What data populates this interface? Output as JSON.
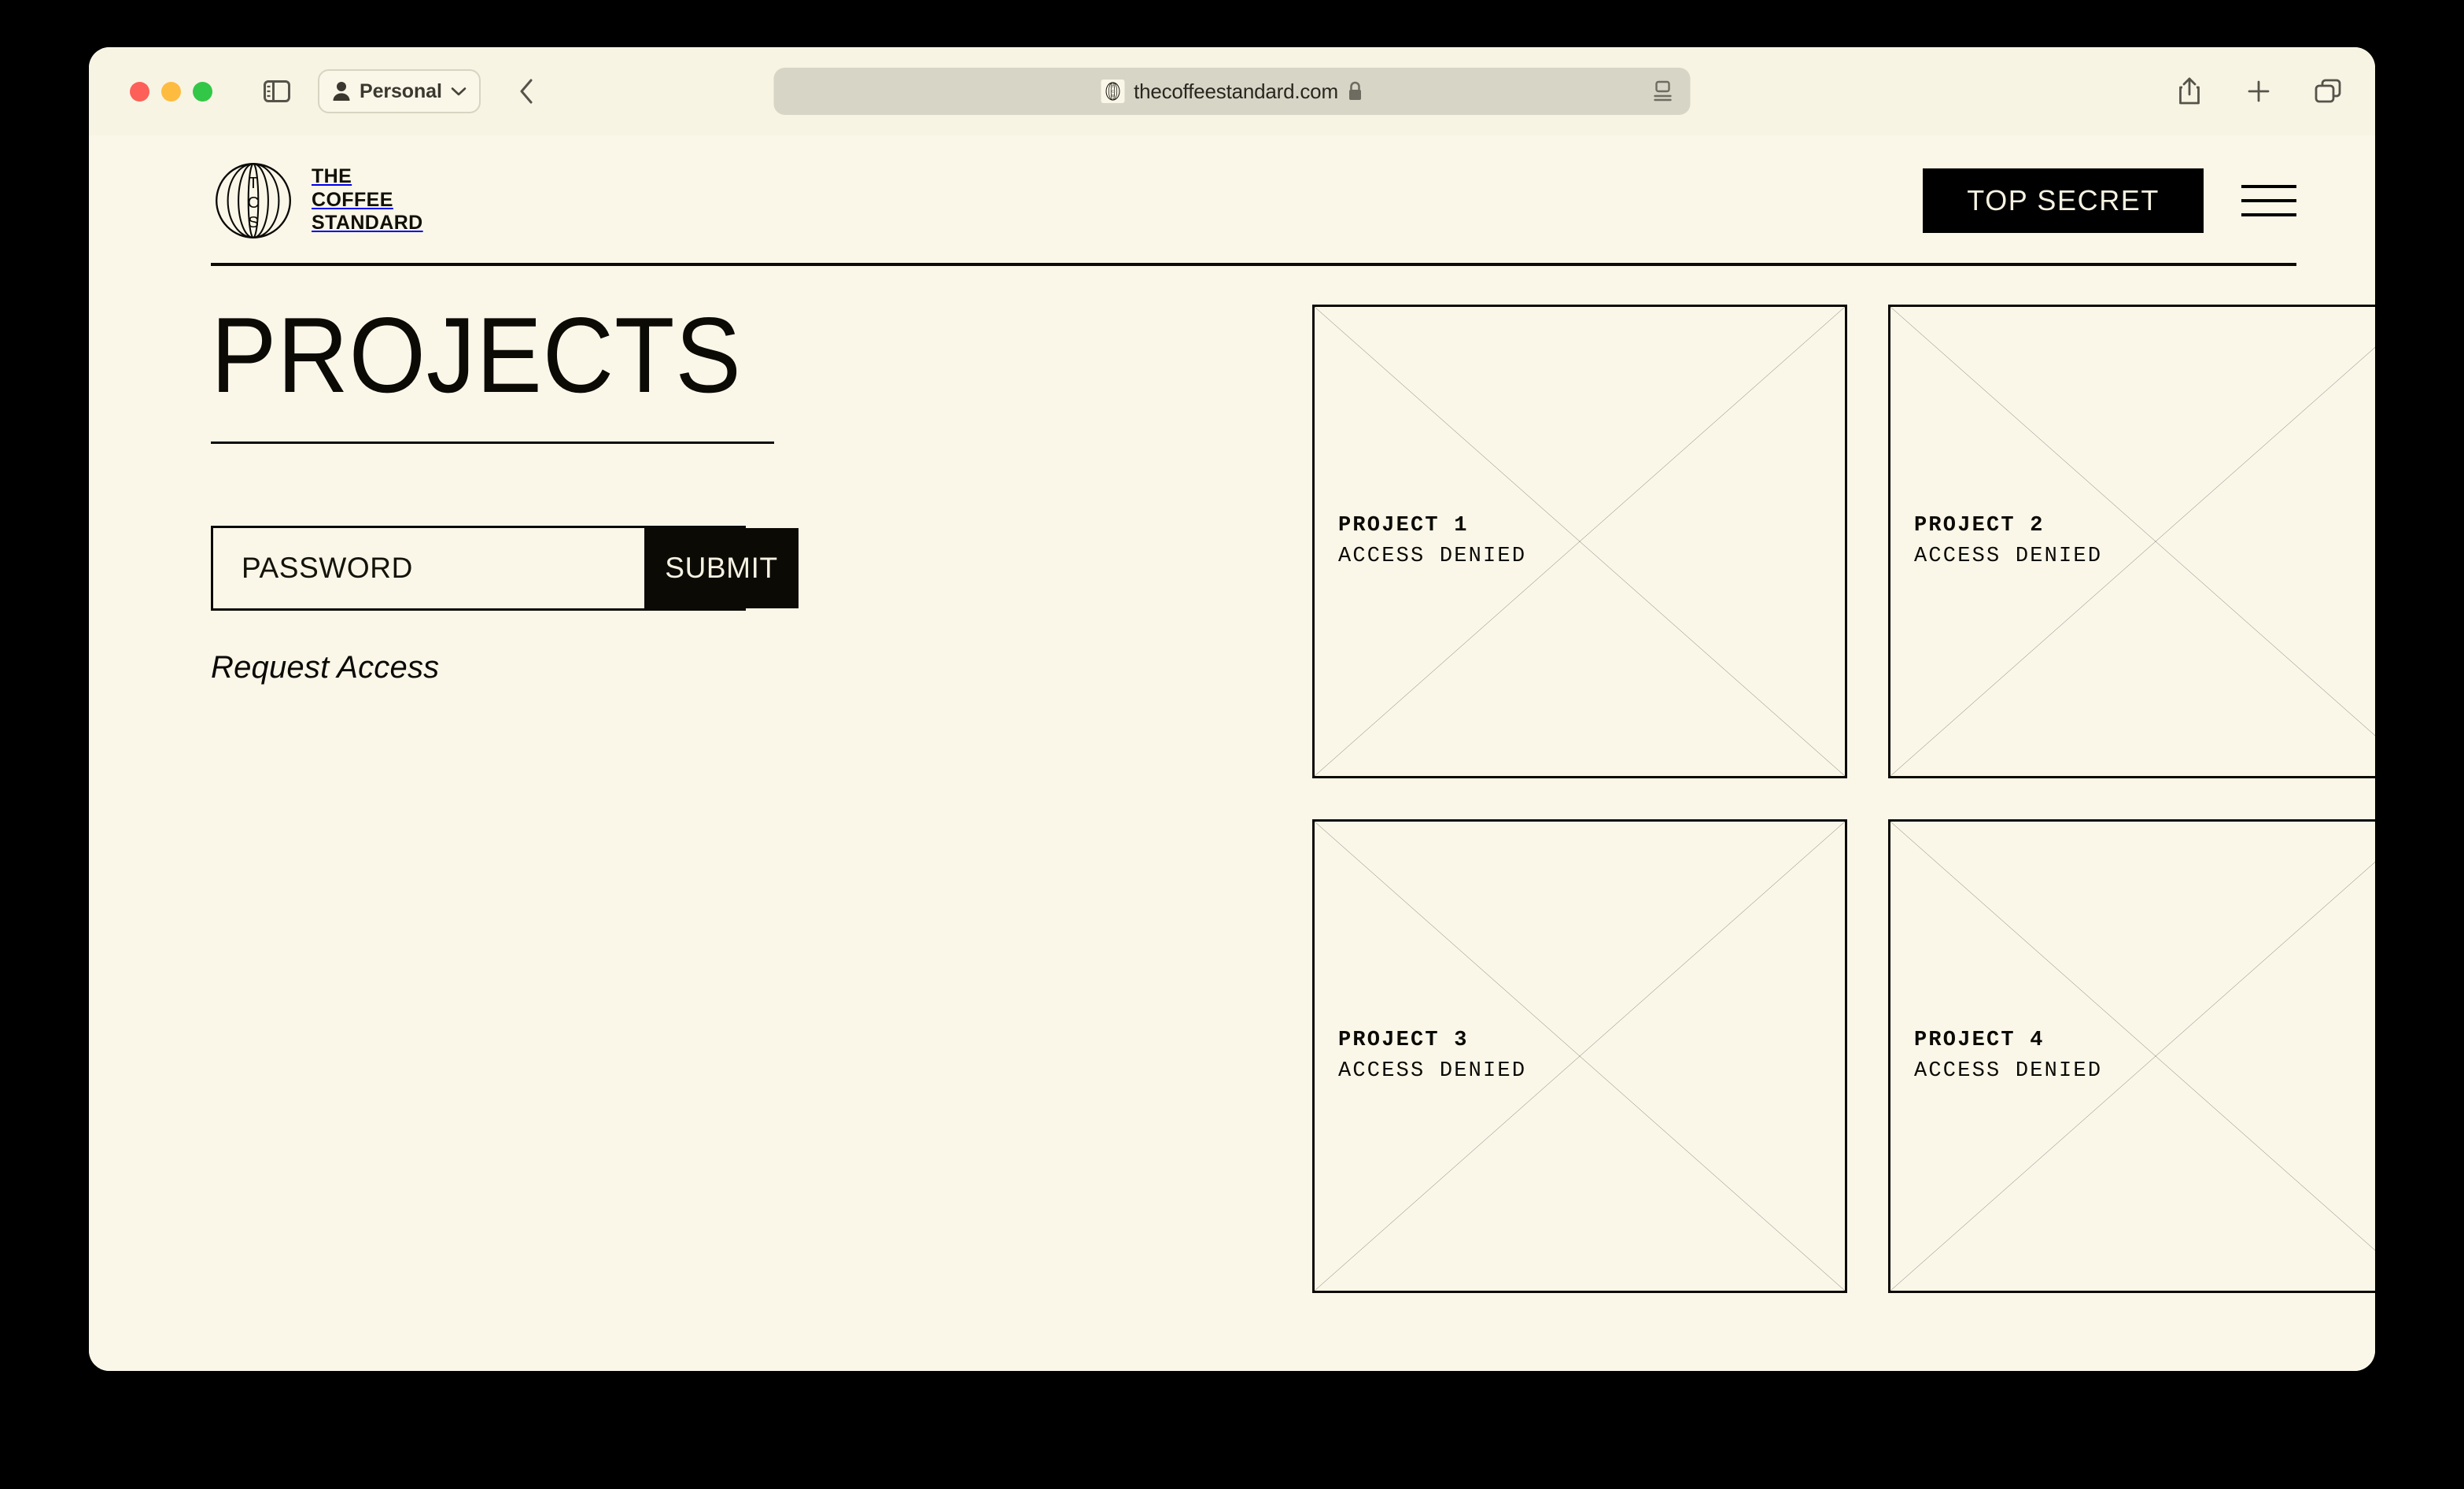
{
  "browser": {
    "traffic_lights": [
      "close",
      "minimize",
      "maximize"
    ],
    "sidebar_toggle_icon": "sidebar-icon",
    "profile": {
      "label": "Personal",
      "person_icon": "person-icon",
      "chevron_icon": "chevron-down-icon"
    },
    "back_icon": "chevron-left-icon",
    "address": {
      "favicon": "tcs-favicon",
      "url": "thecoffeestandard.com",
      "lock_icon": "lock-icon",
      "reader_icon": "reader-view-icon"
    },
    "actions": [
      {
        "name": "share-button",
        "icon": "share-icon"
      },
      {
        "name": "new-tab-button",
        "icon": "plus-icon"
      },
      {
        "name": "tab-overview-button",
        "icon": "tabs-icon"
      }
    ]
  },
  "site": {
    "brand": {
      "monogram": "TCS",
      "line1": "THE",
      "line2": "COFFEE",
      "line3": "STANDARD"
    },
    "top_secret_label": "TOP SECRET",
    "menu_icon": "hamburger-icon"
  },
  "main": {
    "title": "PROJECTS",
    "form": {
      "password_placeholder": "PASSWORD",
      "password_value": "",
      "submit_label": "SUBMIT"
    },
    "request_access_label": "Request Access"
  },
  "projects": [
    {
      "title": "PROJECT 1",
      "status": "ACCESS DENIED"
    },
    {
      "title": "PROJECT 2",
      "status": "ACCESS DENIED"
    },
    {
      "title": "PROJECT 3",
      "status": "ACCESS DENIED"
    },
    {
      "title": "PROJECT 4",
      "status": "ACCESS DENIED"
    }
  ],
  "colors": {
    "page_background": "#FAF7E9",
    "desktop_background": "#000000",
    "ink": "#0B0A05",
    "accent_black": "#000000",
    "address_bar": "#D7D5C6",
    "traffic_red": "#FC6058",
    "traffic_yellow": "#FDBC40",
    "traffic_green": "#33C748"
  }
}
